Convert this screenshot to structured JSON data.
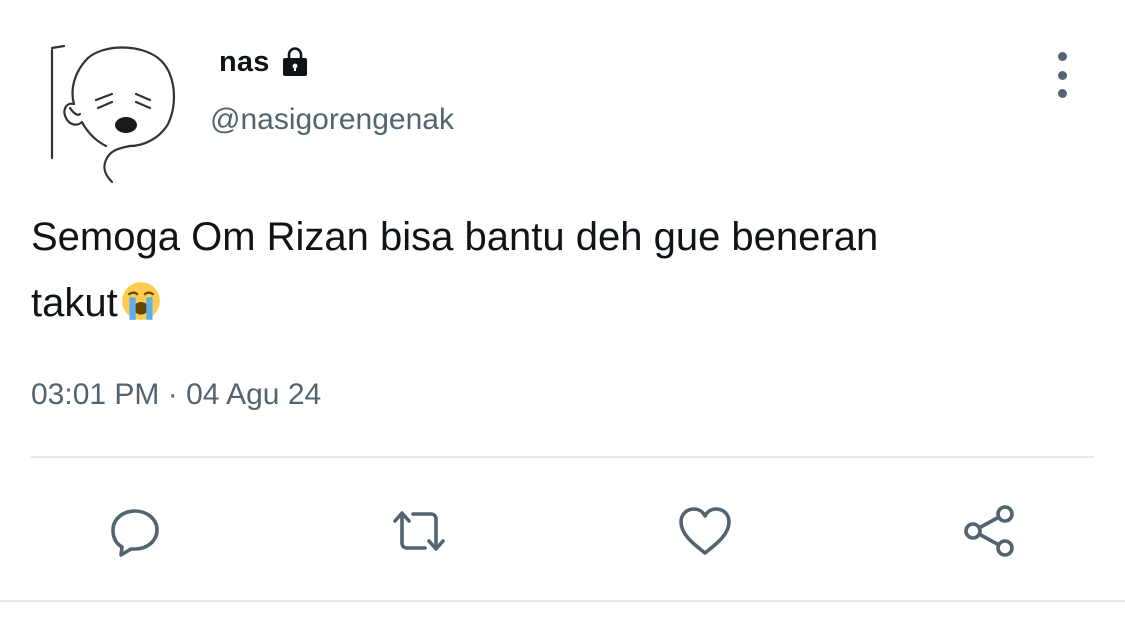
{
  "tweet": {
    "display_name": "nas",
    "handle": "@nasigorengenak",
    "text_line1": "Semoga Om Rizan bisa bantu deh gue beneran",
    "text_line2": "takut",
    "emoji": "loudly-crying-face",
    "timestamp": "03:01 PM · 04 Agu 24",
    "protected": true
  },
  "icons": {
    "lock": "lock-icon",
    "more": "more-vertical-icon",
    "reply": "reply-icon",
    "retweet": "retweet-icon",
    "like": "heart-icon",
    "share": "share-icon"
  },
  "colors": {
    "text": "#0f1419",
    "secondary": "#536471",
    "divider": "#e6e9ec",
    "background": "#ffffff"
  }
}
